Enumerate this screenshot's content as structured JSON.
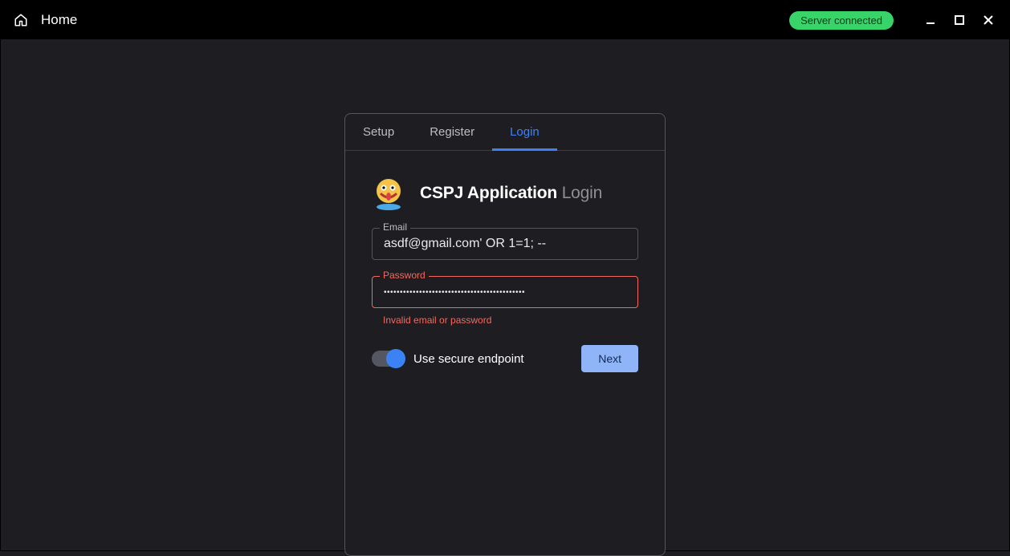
{
  "window": {
    "title": "Home",
    "status": "Server connected",
    "status_color": "#38d46a"
  },
  "tabs": [
    {
      "label": "Setup",
      "active": false
    },
    {
      "label": "Register",
      "active": false
    },
    {
      "label": "Login",
      "active": true
    }
  ],
  "login": {
    "app_name": "CSPJ Application",
    "heading_suffix": "Login",
    "email_label": "Email",
    "email_value": "asdf@gmail.com' OR 1=1; --",
    "password_label": "Password",
    "password_value": "••••••••••••••••••••••••••••••••••••••••••••",
    "error_text": "Invalid email or password",
    "switch_label": "Use secure endpoint",
    "switch_on": true,
    "next_label": "Next"
  },
  "icons": {
    "home": "home-icon",
    "minimize": "minimize-icon",
    "maximize": "maximize-icon",
    "close": "close-icon"
  }
}
